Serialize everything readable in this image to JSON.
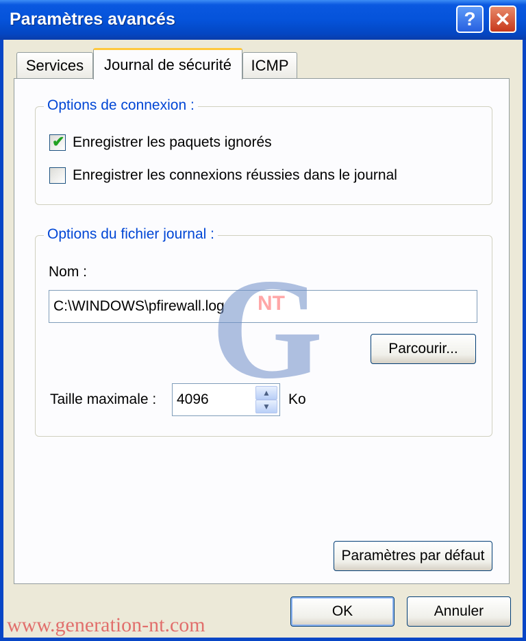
{
  "window": {
    "title": "Paramètres avancés",
    "help_glyph": "?",
    "close_glyph": "✕"
  },
  "tabs": [
    {
      "label": "Services"
    },
    {
      "label": "Journal de sécurité",
      "active": true
    },
    {
      "label": "ICMP"
    }
  ],
  "connection_options": {
    "legend": "Options de connexion :",
    "log_dropped": {
      "label": "Enregistrer les paquets ignorés",
      "checked": true
    },
    "log_success": {
      "label": "Enregistrer les connexions réussies dans le journal",
      "checked": false
    }
  },
  "log_file_options": {
    "legend": "Options du fichier journal :",
    "name_label": "Nom :",
    "name_value": "C:\\WINDOWS\\pfirewall.log",
    "browse_label": "Parcourir...",
    "max_size_label": "Taille maximale :",
    "max_size_value": "4096",
    "unit": "Ko"
  },
  "defaults_button": "Paramètres par défaut",
  "ok_button": "OK",
  "cancel_button": "Annuler",
  "watermark": {
    "nt": "NT",
    "url": "www.generation-nt.com"
  },
  "colors": {
    "title_bar": "#0553DA",
    "legend_text": "#0046D5",
    "check": "#21A121",
    "face": "#ECE9D8"
  }
}
